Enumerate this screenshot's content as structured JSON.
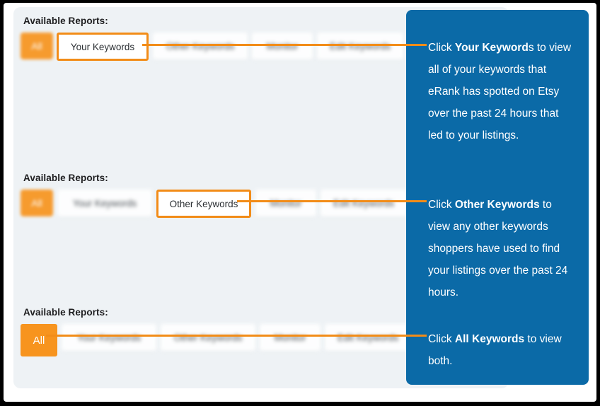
{
  "app": {
    "card_label": "Available Reports:",
    "accent_orange": "#F28C18",
    "all_button_orange": "#F7941E",
    "callout_blue": "#0B6AA7",
    "card_bg": "#EEF2F5"
  },
  "rows": [
    {
      "label": "Available Reports:",
      "all_tab": "All",
      "tabs": [
        "Your Keywords",
        "Other Keywords",
        "Monitor",
        "Edit Keywords"
      ],
      "highlighted": "Your Keywords"
    },
    {
      "label": "Available Reports:",
      "all_tab": "All",
      "tabs": [
        "Your Keywords",
        "Other Keywords",
        "Monitor",
        "Edit Keywords"
      ],
      "highlighted": "Other Keywords"
    },
    {
      "label": "Available Reports:",
      "all_tab": "All",
      "tabs": [
        "Your Keywords",
        "Other Keywords",
        "Monitor",
        "Edit Keywords"
      ],
      "highlighted": "All"
    }
  ],
  "callout": {
    "blocks": [
      {
        "lead": "Click ",
        "bold": "Your Keyword",
        "rest": "s to view all of your keywords that eRank has spotted on Etsy over the past 24 hours that led to your listings."
      },
      {
        "lead": "Click ",
        "bold": "Other Keywords",
        "rest": " to view any other keywords shoppers have used to find your listings over the past 24 hours."
      },
      {
        "lead": "Click ",
        "bold": "All Keywords",
        "rest": " to view both."
      }
    ]
  }
}
